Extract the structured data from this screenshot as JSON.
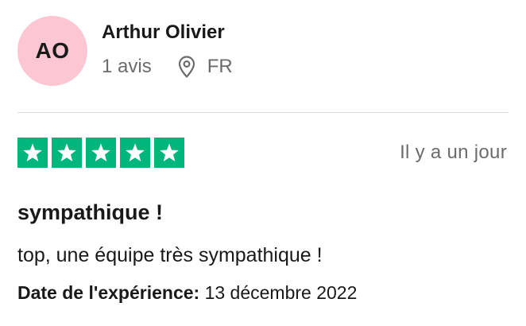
{
  "reviewer": {
    "initials": "AO",
    "avatar_color": "#fcc6d2",
    "name": "Arthur Olivier",
    "review_count": "1 avis",
    "location_icon": "location-pin-icon",
    "country": "FR"
  },
  "review": {
    "rating": 5,
    "rating_max": 5,
    "star_color": "#00b67a",
    "relative_date": "Il y a un jour",
    "title": "sympathique !",
    "text": "top, une équipe très sympathique !",
    "experience_label": "Date de l'expérience:",
    "experience_date": "13 décembre 2022"
  }
}
